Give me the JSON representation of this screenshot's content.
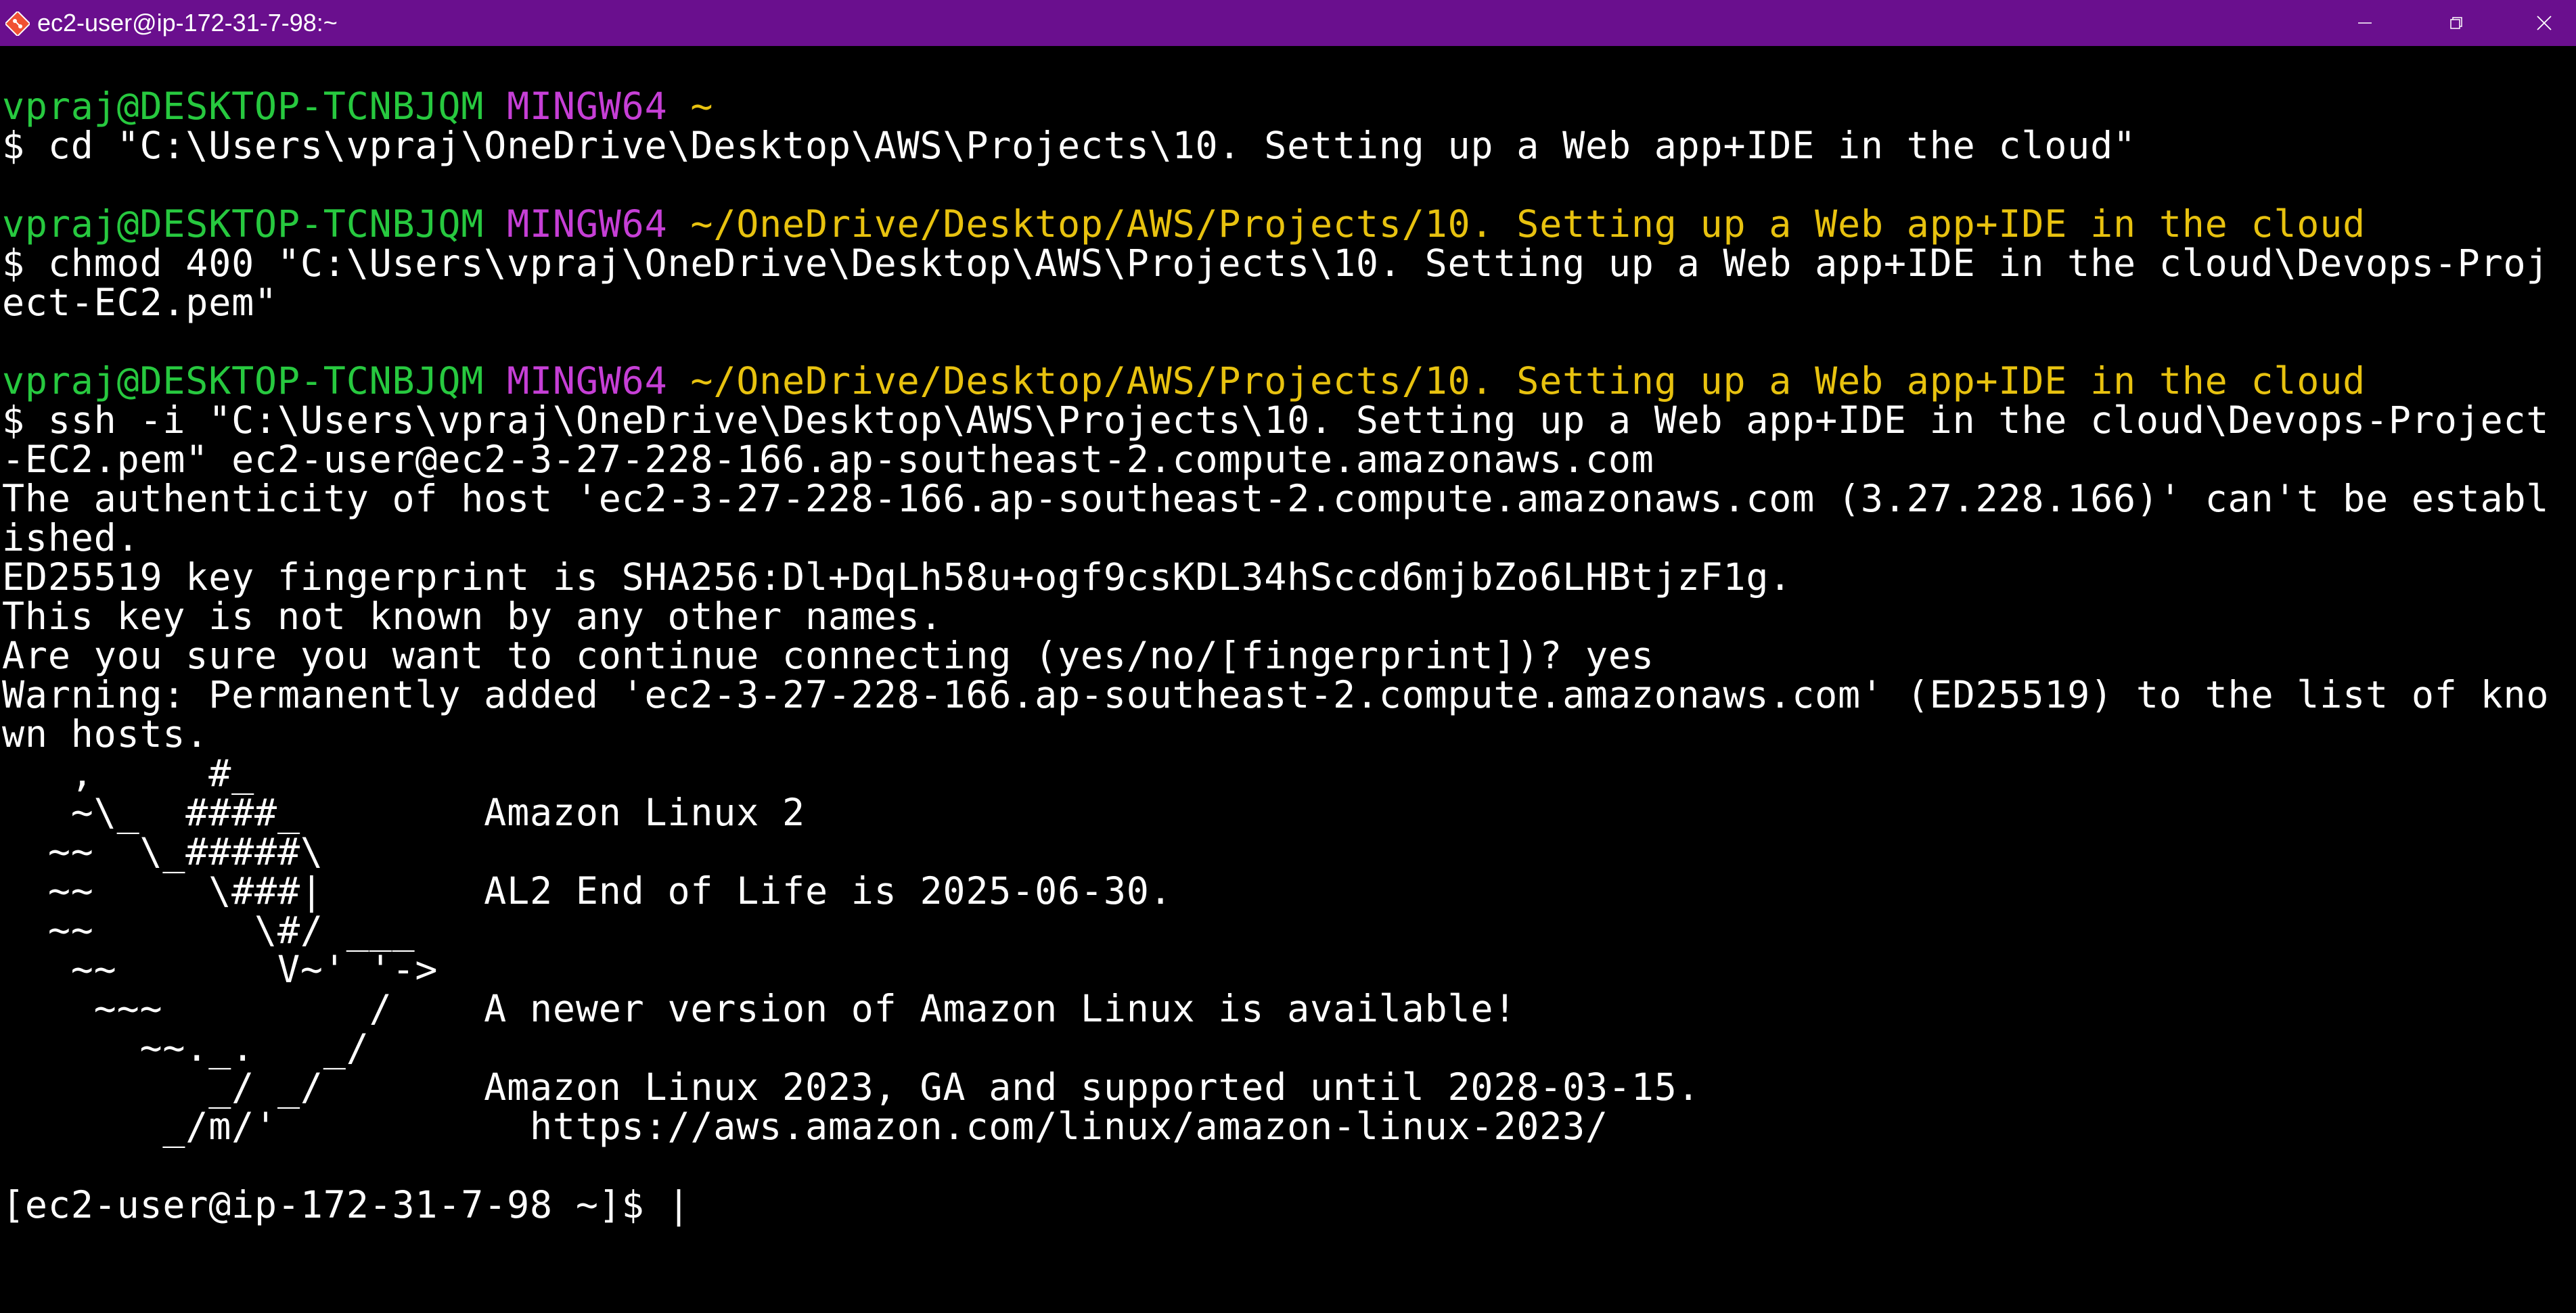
{
  "window": {
    "title": "ec2-user@ip-172-31-7-98:~",
    "icon": "git-bash-icon",
    "controls": [
      "minimize-icon",
      "maximize-icon",
      "close-icon"
    ]
  },
  "colors": {
    "titlebar": "#6a0f8e",
    "background": "#000000",
    "user_host": "#27c93f",
    "mingw": "#c63fd6",
    "path": "#e8c20f",
    "text": "#ffffff"
  },
  "terminal": {
    "prompt1": {
      "user_host": "vpraj@DESKTOP-TCNBJQM",
      "system": "MINGW64",
      "path": "~"
    },
    "cmd1": "$ cd \"C:\\Users\\vpraj\\OneDrive\\Desktop\\AWS\\Projects\\10. Setting up a Web app+IDE in the cloud\"",
    "prompt2": {
      "user_host": "vpraj@DESKTOP-TCNBJQM",
      "system": "MINGW64",
      "path": "~/OneDrive/Desktop/AWS/Projects/10. Setting up a Web app+IDE in the cloud"
    },
    "cmd2_line1": "$ chmod 400 \"C:\\Users\\vpraj\\OneDrive\\Desktop\\AWS\\Projects\\10. Setting up a Web app+IDE in the cloud\\Devops-Proj",
    "cmd2_line2": "ect-EC2.pem\"",
    "prompt3": {
      "user_host": "vpraj@DESKTOP-TCNBJQM",
      "system": "MINGW64",
      "path": "~/OneDrive/Desktop/AWS/Projects/10. Setting up a Web app+IDE in the cloud"
    },
    "cmd3_line1": "$ ssh -i \"C:\\Users\\vpraj\\OneDrive\\Desktop\\AWS\\Projects\\10. Setting up a Web app+IDE in the cloud\\Devops-Project",
    "cmd3_line2": "-EC2.pem\" ec2-user@ec2-3-27-228-166.ap-southeast-2.compute.amazonaws.com",
    "output": [
      "The authenticity of host 'ec2-3-27-228-166.ap-southeast-2.compute.amazonaws.com (3.27.228.166)' can't be establ",
      "ished.",
      "ED25519 key fingerprint is SHA256:Dl+DqLh58u+ogf9csKDL34hSccd6mjbZo6LHBtjzF1g.",
      "This key is not known by any other names.",
      "Are you sure you want to continue connecting (yes/no/[fingerprint])? yes",
      "Warning: Permanently added 'ec2-3-27-228-166.ap-southeast-2.compute.amazonaws.com' (ED25519) to the list of kno",
      "wn hosts."
    ],
    "motd": [
      "   ,     #_",
      "   ~\\_  ####_        Amazon Linux 2",
      "  ~~  \\_#####\\",
      "  ~~     \\###|       AL2 End of Life is 2025-06-30.",
      "  ~~       \\#/ ___",
      "   ~~       V~' '->",
      "    ~~~         /    A newer version of Amazon Linux is available!",
      "      ~~._.   _/",
      "         _/ _/       Amazon Linux 2023, GA and supported until 2028-03-15.",
      "       _/m/'           https://aws.amazon.com/linux/amazon-linux-2023/"
    ],
    "final_prompt": "[ec2-user@ip-172-31-7-98 ~]$ ",
    "cursor": "|"
  }
}
